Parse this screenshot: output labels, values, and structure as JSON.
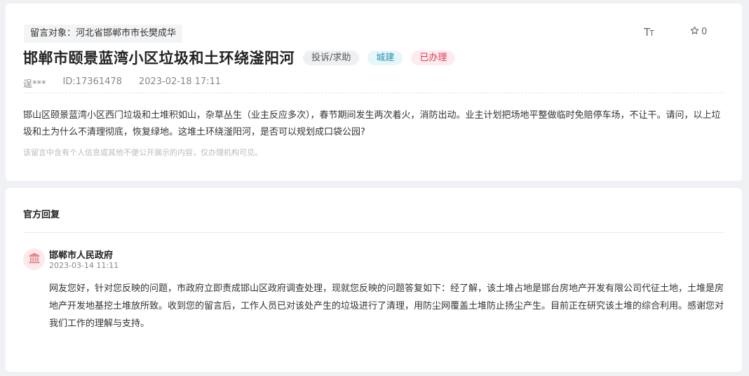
{
  "message": {
    "target_label": "留言对象：河北省邯郸市市长樊成华",
    "title": "邯郸市颐景蓝湾小区垃圾和土环绕滏阳河",
    "badges": {
      "type": "投诉/求助",
      "category": "城建",
      "status": "已办理"
    },
    "author": "逞***",
    "id": "ID:17361478",
    "datetime": "2023-02-18 17:11",
    "content": "邯山区颐景蓝湾小区西门垃圾和土堆积如山，杂草丛生（业主反应多次），春节期间发生两次着火，消防出动。业主计划把场地平整做临时免赔停车场，不让干。请问，以上垃圾和土为什么不清理彻底，恢复绿地。这堆土环绕滏阳河，是否可以规划成口袋公园?",
    "privacy_note": "该留言中含有个人信息或其他不便公开展示的内容，仅办理机构可见。"
  },
  "toolbar": {
    "font_size_icon": "font-size-icon",
    "favorite_icon": "star-outline-icon",
    "favorite_count": "0"
  },
  "reply": {
    "heading": "官方回复",
    "avatar_icon": "government-building-icon",
    "org_name": "邯郸市人民政府",
    "datetime": "2023-03-14 11:11",
    "content": "网友您好，针对您反映的问题，市政府立即责成邯山区政府调查处理，现就您反映的问题答复如下：经了解，该土堆占地是邯台房地产开发有限公司代征土地，土堆是房地产开发地基挖土堆放所致。收到您的留言后，工作人员已对该处产生的垃圾进行了清理，用防尘网覆盖土堆防止扬尘产生。目前正在研究该土堆的综合利用。感谢您对我们工作的理解与支持。"
  },
  "colors": {
    "status_red": "#e0394f",
    "category_blue": "#2a8fb0",
    "avatar_bg": "#fde9ea"
  }
}
